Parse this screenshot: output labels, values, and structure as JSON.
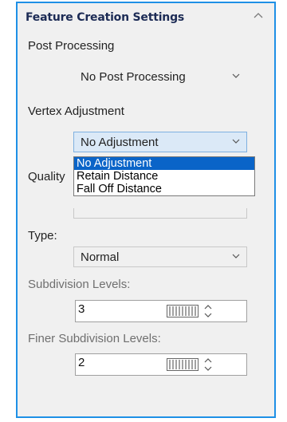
{
  "panel": {
    "title": "Feature Creation Settings",
    "collapse_icon": "chevron-up-icon"
  },
  "post_processing": {
    "label": "Post Processing",
    "value": "No Post Processing"
  },
  "vertex_adjustment": {
    "label": "Vertex Adjustment",
    "value": "No Adjustment",
    "options": [
      "No Adjustment",
      "Retain Distance",
      "Fall Off Distance"
    ],
    "selected_index": 0
  },
  "quality": {
    "label": "Quality"
  },
  "type": {
    "label": "Type:",
    "value": "Normal"
  },
  "subdivision_levels": {
    "label": "Subdivision Levels:",
    "value": "3"
  },
  "finer_subdivision_levels": {
    "label": "Finer Subdivision Levels:",
    "value": "2"
  },
  "colors": {
    "accent": "#1e90e6",
    "selection": "#0a64c8",
    "panel_bg": "#f0f0f0"
  }
}
